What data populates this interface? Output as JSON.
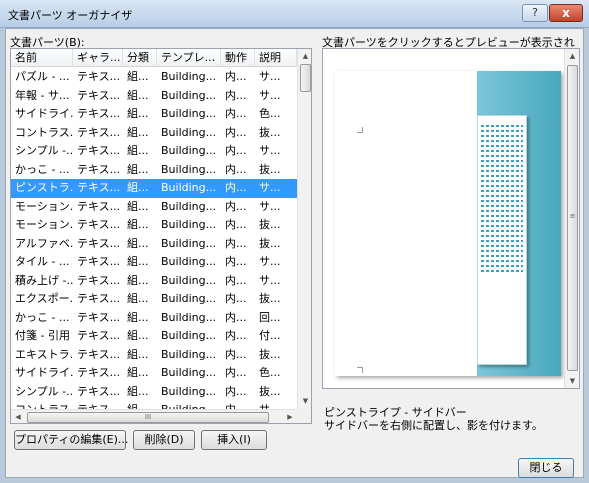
{
  "window": {
    "title": "文書パーツ オーガナイザ",
    "help_label": "?",
    "close_label": "x"
  },
  "list_label": "文書パーツ(B):",
  "preview_label": "文書パーツをクリックするとプレビューが表示されます",
  "columns": [
    "名前",
    "ギャラ...",
    "分類",
    "テンプレ...",
    "動作",
    "説明"
  ],
  "rows": [
    [
      "パズル - ...",
      "テキス...",
      "組...",
      "Building...",
      "内...",
      "サ..."
    ],
    [
      "年報 - サ...",
      "テキス...",
      "組...",
      "Building...",
      "内...",
      "サ..."
    ],
    [
      "サイドライ...",
      "テキス...",
      "組...",
      "Building...",
      "内...",
      "色..."
    ],
    [
      "コントラス...",
      "テキス...",
      "組...",
      "Building...",
      "内...",
      "抜..."
    ],
    [
      "シンプル -...",
      "テキス...",
      "組...",
      "Building...",
      "内...",
      "サ..."
    ],
    [
      "かっこ - ...",
      "テキス...",
      "組...",
      "Building...",
      "内...",
      "抜..."
    ],
    [
      "ピンストラ...",
      "テキス...",
      "組...",
      "Building...",
      "内...",
      "サ..."
    ],
    [
      "モーション...",
      "テキス...",
      "組...",
      "Building...",
      "内...",
      "サ..."
    ],
    [
      "モーション...",
      "テキス...",
      "組...",
      "Building...",
      "内...",
      "抜..."
    ],
    [
      "アルファベ...",
      "テキス...",
      "組...",
      "Building...",
      "内...",
      "抜..."
    ],
    [
      "タイル - ...",
      "テキス...",
      "組...",
      "Building...",
      "内...",
      "サ..."
    ],
    [
      "積み上げ -...",
      "テキス...",
      "組...",
      "Building...",
      "内...",
      "サ..."
    ],
    [
      "エクスポー...",
      "テキス...",
      "組...",
      "Building...",
      "内...",
      "抜..."
    ],
    [
      "かっこ - ...",
      "テキス...",
      "組...",
      "Building...",
      "内...",
      "回..."
    ],
    [
      "付箋 - 引用",
      "テキス...",
      "組...",
      "Building...",
      "内...",
      "付..."
    ],
    [
      "エキストラ...",
      "テキス...",
      "組...",
      "Building...",
      "内...",
      "抜..."
    ],
    [
      "サイドライ...",
      "テキス...",
      "組...",
      "Building...",
      "内...",
      "色..."
    ],
    [
      "シンプル -...",
      "テキス...",
      "組...",
      "Building...",
      "内...",
      "抜..."
    ],
    [
      "コントラス...",
      "テキス...",
      "組...",
      "Building...",
      "内...",
      "サ..."
    ]
  ],
  "selected_row": 6,
  "scroll_glyphs": {
    "up": "▲",
    "down": "▼",
    "left": "◀",
    "right": "▶",
    "grip_h": "III",
    "grip_v": "≡"
  },
  "preview": {
    "part_name": "ピンストライプ - サイドバー",
    "part_description": "サイドバーを右側に配置し、影を付けます。"
  },
  "buttons": {
    "properties": "プロパティの編集(E)...",
    "delete": "削除(D)",
    "insert": "挿入(I)",
    "close": "閉じる"
  },
  "colors": {
    "selection": "#3399ff",
    "sidebar_accent": "#4aa8bf"
  }
}
